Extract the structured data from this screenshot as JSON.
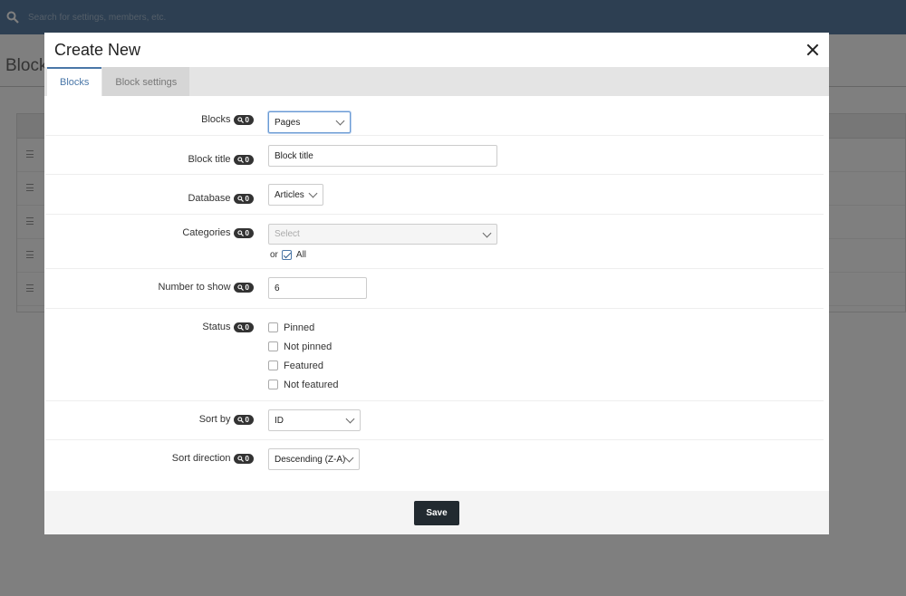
{
  "app": {
    "search_placeholder": "Search for settings, members, etc.",
    "page_title": "Blocks",
    "row_count": 5
  },
  "modal": {
    "title": "Create New",
    "tabs": [
      {
        "label": "Blocks",
        "active": true
      },
      {
        "label": "Block settings",
        "active": false
      }
    ],
    "badge_text": "0",
    "fields": {
      "blocks": {
        "label": "Blocks",
        "value": "Pages"
      },
      "block_title": {
        "label": "Block title",
        "value": "Block title"
      },
      "database": {
        "label": "Database",
        "value": "Articles"
      },
      "categories": {
        "label": "Categories",
        "placeholder": "Select",
        "or_text": "or",
        "all_label": "All",
        "all_checked": true
      },
      "number_to_show": {
        "label": "Number to show",
        "value": "6"
      },
      "status": {
        "label": "Status",
        "options": [
          {
            "label": "Pinned",
            "checked": false
          },
          {
            "label": "Not pinned",
            "checked": false
          },
          {
            "label": "Featured",
            "checked": false
          },
          {
            "label": "Not featured",
            "checked": false
          }
        ]
      },
      "sort_by": {
        "label": "Sort by",
        "value": "ID"
      },
      "sort_direction": {
        "label": "Sort direction",
        "value": "Descending (Z-A)"
      }
    },
    "save_label": "Save"
  },
  "colors": {
    "accent": "#4a77a8",
    "topbar": "#5b7fa5",
    "save_button": "#222a30"
  }
}
